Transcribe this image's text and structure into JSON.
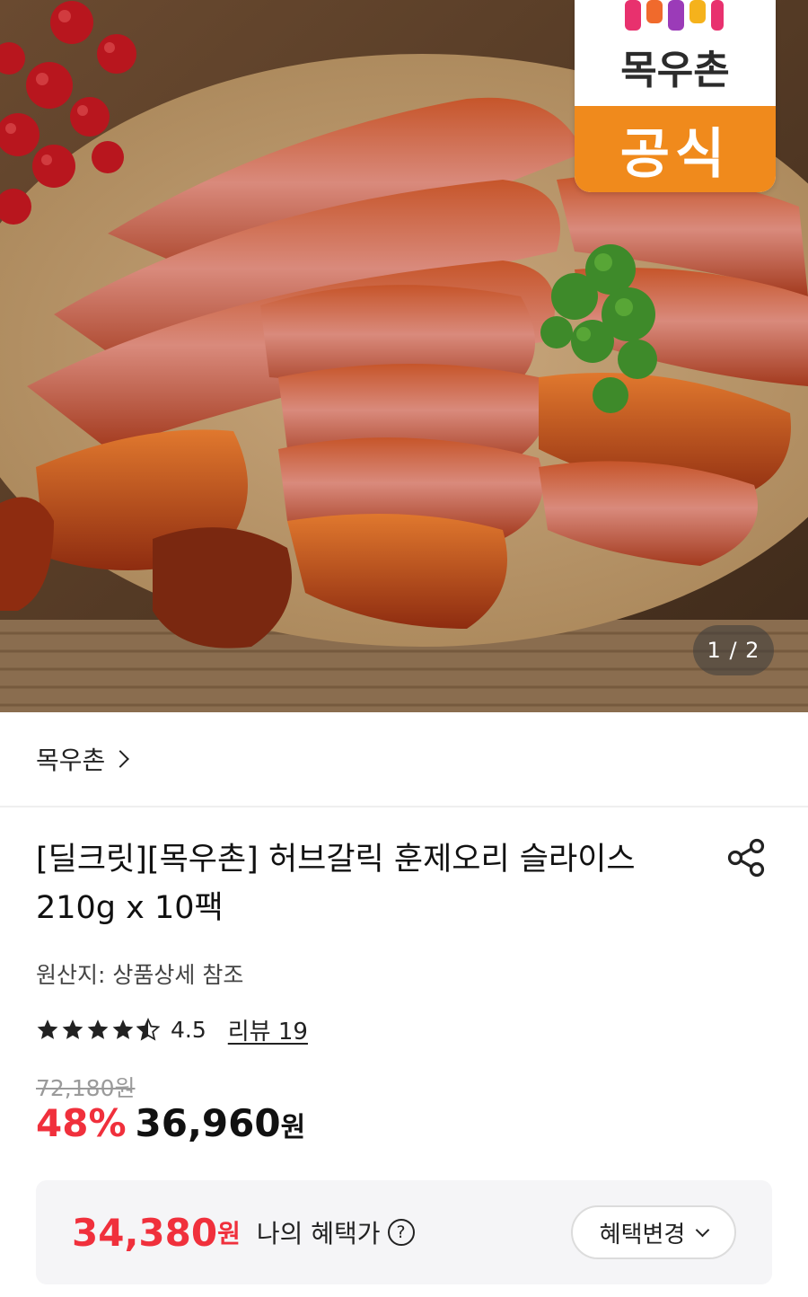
{
  "hero": {
    "badge_brand": "목우촌",
    "badge_tag": "공식",
    "image_counter": "1 / 2"
  },
  "store": {
    "name": "목우촌"
  },
  "product": {
    "title": "[딜크릿][목우촌] 허브갈릭 훈제오리 슬라이스 210g x 10팩",
    "origin": "원산지: 상품상세 참조",
    "rating": "4.5",
    "rating_value": 4.5,
    "rating_max": 5,
    "review_link": "리뷰 19",
    "original_price": "72,180원",
    "discount": "48%",
    "price": "36,960",
    "price_unit": "원"
  },
  "benefit": {
    "price": "34,380",
    "price_unit": "원",
    "label": "나의 혜택가",
    "help_glyph": "?",
    "change_button": "혜택변경"
  },
  "colors": {
    "accent_red": "#f0303c",
    "badge_orange": "#f08a1c"
  },
  "icons": {
    "share": "share-icon",
    "star": "star-icon",
    "help": "question-circle-icon",
    "chevron_right": "chevron-right-icon",
    "chevron_down": "chevron-down-icon"
  }
}
